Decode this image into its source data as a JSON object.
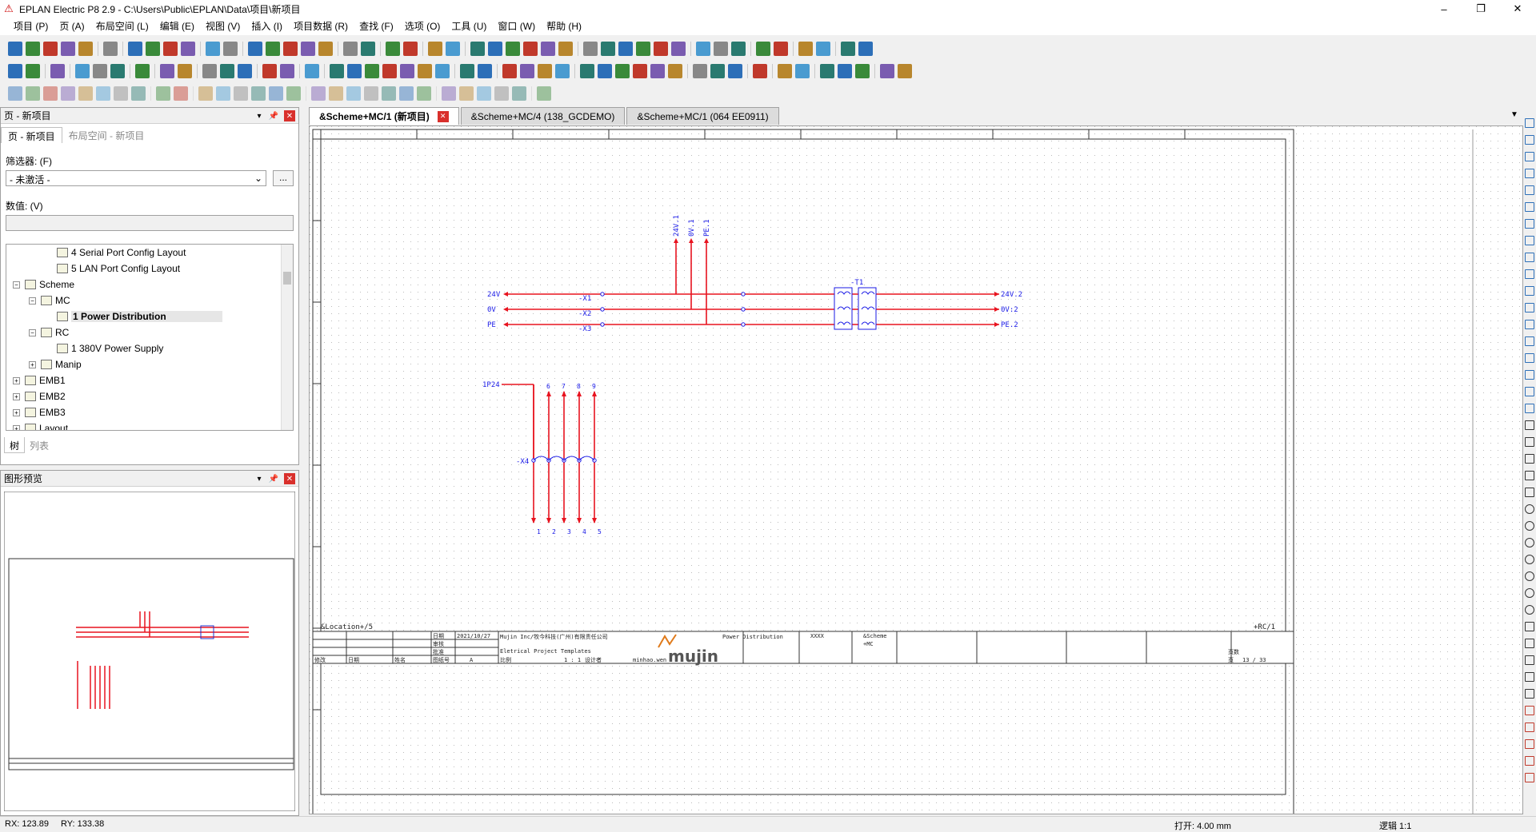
{
  "window": {
    "title": "EPLAN Electric P8 2.9 - C:\\Users\\Public\\EPLAN\\Data\\项目\\新项目",
    "minimize": "–",
    "maximize": "❐",
    "close": "✕"
  },
  "menu": [
    "项目 (P)",
    "页 (A)",
    "布局空间 (L)",
    "编辑 (E)",
    "视图 (V)",
    "插入 (I)",
    "项目数据 (R)",
    "查找 (F)",
    "选项 (O)",
    "工具 (U)",
    "窗口 (W)",
    "帮助 (H)"
  ],
  "pages_panel": {
    "title": "页 - 新项目",
    "tabs": [
      "页 - 新项目",
      "布局空间 - 新项目"
    ],
    "filter_label": "筛选器: (F)",
    "filter_value": "- 未激活 -",
    "filter_button": "...",
    "value_label": "数值: (V)",
    "value_input": "",
    "tree": [
      {
        "label": "4 Serial Port Config Layout",
        "level": 3,
        "expander": "",
        "selected": false
      },
      {
        "label": "5 LAN Port Config Layout",
        "level": 3,
        "expander": "",
        "selected": false
      },
      {
        "label": "Scheme",
        "level": 1,
        "expander": "−",
        "selected": false
      },
      {
        "label": "MC",
        "level": 2,
        "expander": "−",
        "selected": false
      },
      {
        "label": "1 Power Distribution",
        "level": 3,
        "expander": "",
        "selected": true
      },
      {
        "label": "RC",
        "level": 2,
        "expander": "−",
        "selected": false
      },
      {
        "label": "1 380V Power Supply",
        "level": 3,
        "expander": "",
        "selected": false
      },
      {
        "label": "Manip",
        "level": 2,
        "expander": "+",
        "selected": false
      },
      {
        "label": "EMB1",
        "level": 1,
        "expander": "+",
        "selected": false
      },
      {
        "label": "EMB2",
        "level": 1,
        "expander": "+",
        "selected": false
      },
      {
        "label": "EMB3",
        "level": 1,
        "expander": "+",
        "selected": false
      },
      {
        "label": "Layout",
        "level": 1,
        "expander": "+",
        "selected": false
      }
    ],
    "bottom_tabs": [
      "树",
      "列表"
    ]
  },
  "preview_panel": {
    "title": "图形预览"
  },
  "document_tabs": [
    {
      "label": "&Scheme+MC/1 (新项目)",
      "active": true,
      "close": "✕"
    },
    {
      "label": "&Scheme+MC/4 (138_GCDEMO)",
      "active": false
    },
    {
      "label": "&Scheme+MC/1 (064 EE0911)",
      "active": false
    }
  ],
  "tab_dropdown": "▼",
  "schematic": {
    "busbars": [
      {
        "label": "24V",
        "end_label": "24V.2"
      },
      {
        "label": "0V",
        "end_label": "0V:2"
      },
      {
        "label": "PE",
        "end_label": "PE.2"
      }
    ],
    "potential_arrows": [
      "24V.1",
      "0V.1",
      "PE.1"
    ],
    "terminals": [
      "-X1",
      "-X2",
      "-X3"
    ],
    "transformer": "-T1",
    "supply_label": "1P24",
    "terminal_strip": "-X4",
    "strip_top_labels": [
      "6",
      "7",
      "8",
      "9"
    ],
    "strip_numbers": [
      "1",
      "2",
      "3",
      "4",
      "5"
    ],
    "location_label": "&Location+/5",
    "page_ref": "+RC/1"
  },
  "title_block": {
    "date_label": "日期",
    "check_label": "审核",
    "approve_label": "批准",
    "date": "2021/10/27",
    "company": "Mujin Inc/牧今科技(广州)有限责任公司",
    "template": "Eletrical Project Templates",
    "design_label": "设计者",
    "designer": "minhao.wen",
    "scale": "1 : 1",
    "ratio_label": "比例",
    "logo": "mujin",
    "page_title": "Power Distribution",
    "field_xxxx": "XXXX",
    "scheme": "&Scheme",
    "mc": "+MC",
    "page_label": "页数",
    "page_no": "页",
    "page_count": "13 / 33",
    "rev_labels": [
      "修改",
      "日期",
      "姓名",
      "图纸号"
    ],
    "rev_a": "A"
  },
  "status": {
    "rx": "RX: 123.89",
    "ry": "RY: 133.38",
    "grid": "打开: 4.00 mm",
    "logic": "逻辑 1:1"
  },
  "colors": {
    "wire": "#e8131f",
    "label": "#1a1ae6",
    "grid_dot": "#bcbcbc"
  }
}
